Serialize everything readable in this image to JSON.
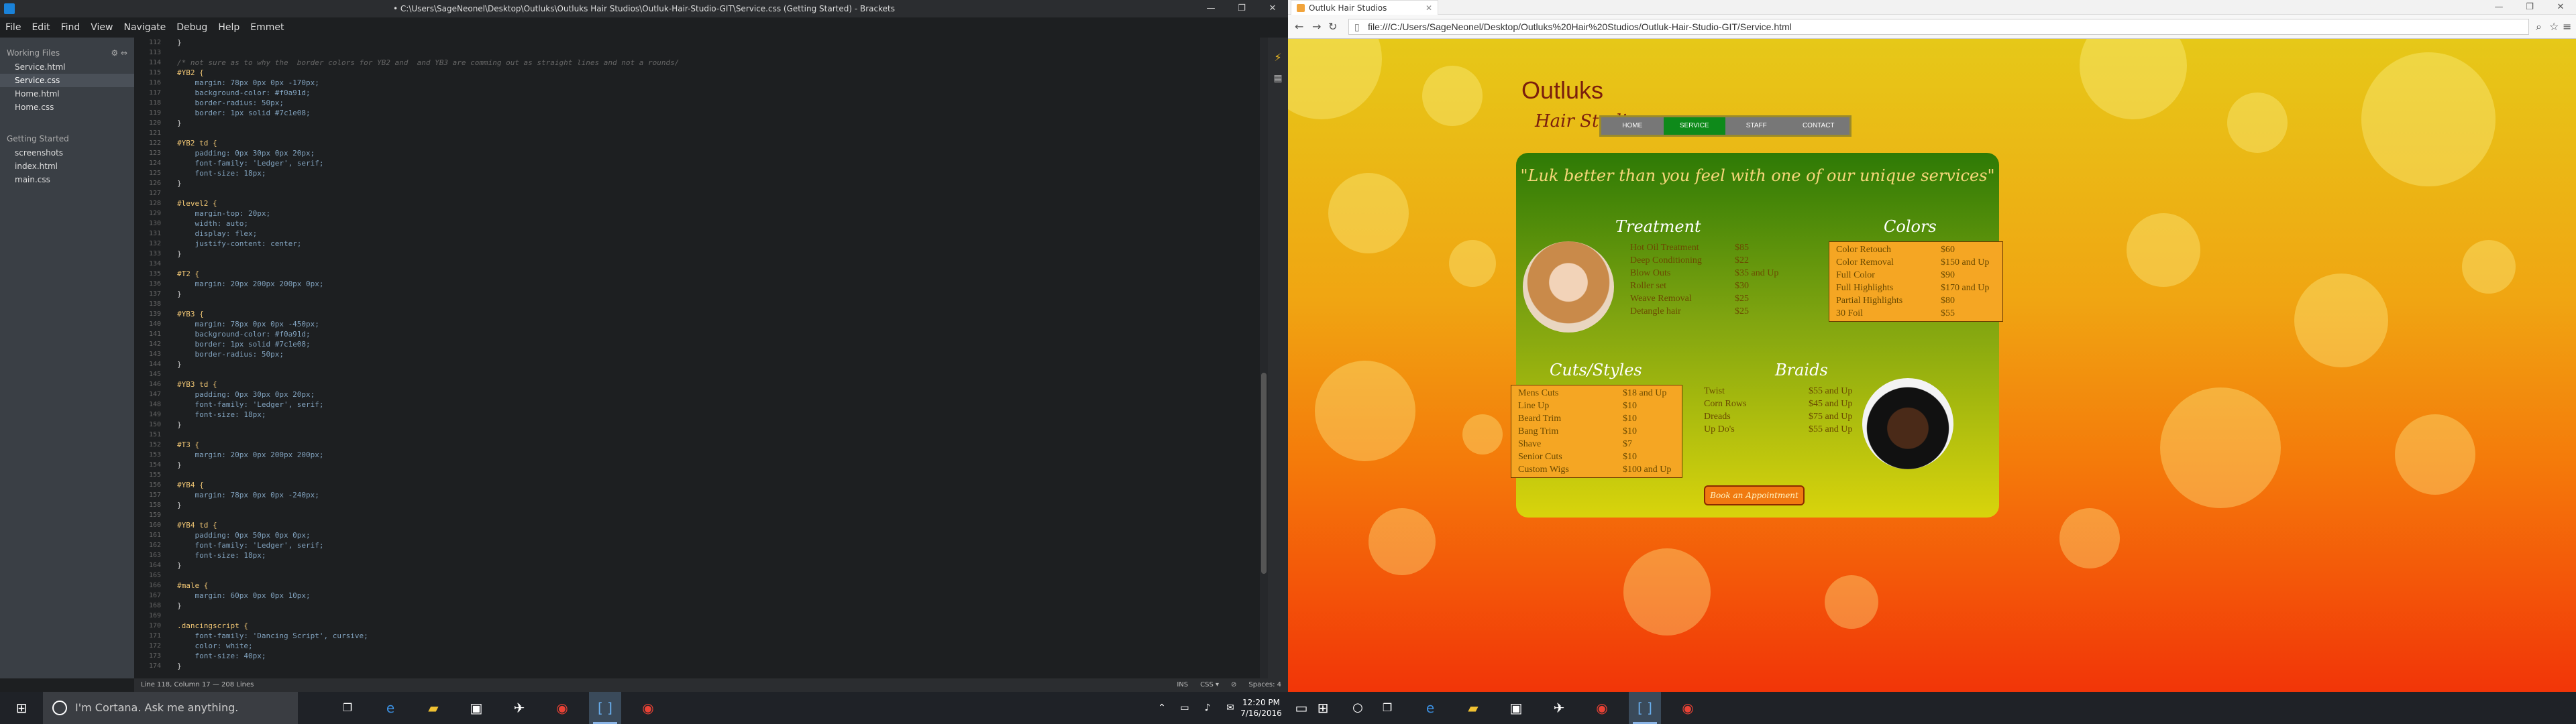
{
  "editor": {
    "title": "• C:\\Users\\SageNeonel\\Desktop\\Outluks\\Outluks Hair Studios\\Outluk-Hair-Studio-GIT\\Service.css (Getting Started) - Brackets",
    "menu": [
      "File",
      "Edit",
      "Find",
      "View",
      "Navigate",
      "Debug",
      "Help",
      "Emmet"
    ],
    "sidebar": {
      "working_files_label": "Working Files",
      "working_files": [
        "Service.html",
        "Service.css",
        "Home.html",
        "Home.css"
      ],
      "project_label": "Getting Started",
      "project_files": [
        "screenshots",
        "index.html",
        "main.css"
      ]
    },
    "code": [
      {
        "n": "112",
        "t": "}",
        "k": "p"
      },
      {
        "n": "113",
        "t": "",
        "k": "p"
      },
      {
        "n": "114",
        "t": "/* not sure as to why the  border colors for YB2 and  and YB3 are comming out as straight lines and not a rounds/",
        "k": "cmt"
      },
      {
        "n": "115",
        "t": "#YB2 {",
        "k": "sel"
      },
      {
        "n": "116",
        "t": "    margin: 78px 0px 0px -170px;",
        "k": "prop"
      },
      {
        "n": "117",
        "t": "    background-color: #f0a91d;",
        "k": "prop"
      },
      {
        "n": "118",
        "t": "    border-radius: 50px;",
        "k": "prop"
      },
      {
        "n": "119",
        "t": "    border: 1px solid #7c1e08;",
        "k": "prop"
      },
      {
        "n": "120",
        "t": "}",
        "k": "p"
      },
      {
        "n": "121",
        "t": "",
        "k": "p"
      },
      {
        "n": "122",
        "t": "#YB2 td {",
        "k": "sel"
      },
      {
        "n": "123",
        "t": "    padding: 0px 30px 0px 20px;",
        "k": "prop"
      },
      {
        "n": "124",
        "t": "    font-family: 'Ledger', serif;",
        "k": "prop"
      },
      {
        "n": "125",
        "t": "    font-size: 18px;",
        "k": "prop"
      },
      {
        "n": "126",
        "t": "}",
        "k": "p"
      },
      {
        "n": "127",
        "t": "",
        "k": "p"
      },
      {
        "n": "128",
        "t": "#level2 {",
        "k": "sel"
      },
      {
        "n": "129",
        "t": "    margin-top: 20px;",
        "k": "prop"
      },
      {
        "n": "130",
        "t": "    width: auto;",
        "k": "prop"
      },
      {
        "n": "131",
        "t": "    display: flex;",
        "k": "prop"
      },
      {
        "n": "132",
        "t": "    justify-content: center;",
        "k": "prop"
      },
      {
        "n": "133",
        "t": "}",
        "k": "p"
      },
      {
        "n": "134",
        "t": "",
        "k": "p"
      },
      {
        "n": "135",
        "t": "#T2 {",
        "k": "sel"
      },
      {
        "n": "136",
        "t": "    margin: 20px 200px 200px 0px;",
        "k": "prop"
      },
      {
        "n": "137",
        "t": "}",
        "k": "p"
      },
      {
        "n": "138",
        "t": "",
        "k": "p"
      },
      {
        "n": "139",
        "t": "#YB3 {",
        "k": "sel"
      },
      {
        "n": "140",
        "t": "    margin: 78px 0px 0px -450px;",
        "k": "prop"
      },
      {
        "n": "141",
        "t": "    background-color: #f0a91d;",
        "k": "prop"
      },
      {
        "n": "142",
        "t": "    border: 1px solid #7c1e08;",
        "k": "prop"
      },
      {
        "n": "143",
        "t": "    border-radius: 50px;",
        "k": "prop"
      },
      {
        "n": "144",
        "t": "}",
        "k": "p"
      },
      {
        "n": "145",
        "t": "",
        "k": "p"
      },
      {
        "n": "146",
        "t": "#YB3 td {",
        "k": "sel"
      },
      {
        "n": "147",
        "t": "    padding: 0px 30px 0px 20px;",
        "k": "prop"
      },
      {
        "n": "148",
        "t": "    font-family: 'Ledger', serif;",
        "k": "prop"
      },
      {
        "n": "149",
        "t": "    font-size: 18px;",
        "k": "prop"
      },
      {
        "n": "150",
        "t": "}",
        "k": "p"
      },
      {
        "n": "151",
        "t": "",
        "k": "p"
      },
      {
        "n": "152",
        "t": "#T3 {",
        "k": "sel"
      },
      {
        "n": "153",
        "t": "    margin: 20px 0px 200px 200px;",
        "k": "prop"
      },
      {
        "n": "154",
        "t": "}",
        "k": "p"
      },
      {
        "n": "155",
        "t": "",
        "k": "p"
      },
      {
        "n": "156",
        "t": "#YB4 {",
        "k": "sel"
      },
      {
        "n": "157",
        "t": "    margin: 78px 0px 0px -240px;",
        "k": "prop"
      },
      {
        "n": "158",
        "t": "}",
        "k": "p"
      },
      {
        "n": "159",
        "t": "",
        "k": "p"
      },
      {
        "n": "160",
        "t": "#YB4 td {",
        "k": "sel"
      },
      {
        "n": "161",
        "t": "    padding: 0px 50px 0px 0px;",
        "k": "prop"
      },
      {
        "n": "162",
        "t": "    font-family: 'Ledger', serif;",
        "k": "prop"
      },
      {
        "n": "163",
        "t": "    font-size: 18px;",
        "k": "prop"
      },
      {
        "n": "164",
        "t": "}",
        "k": "p"
      },
      {
        "n": "165",
        "t": "",
        "k": "p"
      },
      {
        "n": "166",
        "t": "#male {",
        "k": "sel"
      },
      {
        "n": "167",
        "t": "    margin: 60px 0px 0px 10px;",
        "k": "prop"
      },
      {
        "n": "168",
        "t": "}",
        "k": "p"
      },
      {
        "n": "169",
        "t": "",
        "k": "p"
      },
      {
        "n": "170",
        "t": ".dancingscript {",
        "k": "sel"
      },
      {
        "n": "171",
        "t": "    font-family: 'Dancing Script', cursive;",
        "k": "prop"
      },
      {
        "n": "172",
        "t": "    color: white;",
        "k": "prop"
      },
      {
        "n": "173",
        "t": "    font-size: 40px;",
        "k": "prop"
      },
      {
        "n": "174",
        "t": "}",
        "k": "p"
      }
    ],
    "status_left": "Line 118, Column 17 — 208 Lines",
    "status_right": [
      "INS",
      "CSS ▾",
      "⊘",
      "Spaces: 4"
    ]
  },
  "browser": {
    "tab_title": "Outluk Hair Studios",
    "url": "file:///C:/Users/SageNeonel/Desktop/Outluks%20Hair%20Studios/Outluk-Hair-Studio-GIT/Service.html",
    "site": {
      "brand": "Outluks",
      "brand_sub": "Hair Studios",
      "nav": [
        "HOME",
        "SERVICE",
        "STAFF",
        "CONTACT"
      ],
      "quote": "\"Luk better than you feel with one of our unique services\"",
      "treatment_title": "Treatment",
      "treatment": [
        {
          "name": "Hot Oil Treatment",
          "price": "$85"
        },
        {
          "name": "Deep Conditioning",
          "price": "$22"
        },
        {
          "name": "Blow Outs",
          "price": "$35 and Up"
        },
        {
          "name": "Roller set",
          "price": "$30"
        },
        {
          "name": "Weave Removal",
          "price": "$25"
        },
        {
          "name": "Detangle hair",
          "price": "$25"
        }
      ],
      "colors_title": "Colors",
      "colors": [
        {
          "name": "Color Retouch",
          "price": "$60"
        },
        {
          "name": "Color Removal",
          "price": "$150 and Up"
        },
        {
          "name": "Full Color",
          "price": "$90"
        },
        {
          "name": "Full Highlights",
          "price": "$170 and Up"
        },
        {
          "name": "Partial Highlights",
          "price": "$80"
        },
        {
          "name": "30 Foil",
          "price": "$55"
        }
      ],
      "cuts_title": "Cuts/Styles",
      "cuts": [
        {
          "name": "Mens Cuts",
          "price": "$18 and Up"
        },
        {
          "name": "Line Up",
          "price": "$10"
        },
        {
          "name": "Beard Trim",
          "price": "$10"
        },
        {
          "name": "Bang Trim",
          "price": "$10"
        },
        {
          "name": "Shave",
          "price": "$7"
        },
        {
          "name": "Senior Cuts",
          "price": "$10"
        },
        {
          "name": "Custom Wigs",
          "price": "$100 and Up"
        }
      ],
      "braids_title": "Braids",
      "braids": [
        {
          "name": "Twist",
          "price": "$55 and Up"
        },
        {
          "name": "Corn Rows",
          "price": "$45 and Up"
        },
        {
          "name": "Dreads",
          "price": "$75 and Up"
        },
        {
          "name": "Up Do's",
          "price": "$55 and Up"
        }
      ],
      "book_button": "Book an Appointment"
    }
  },
  "taskbar": {
    "cortana": "I'm Cortana. Ask me anything.",
    "time": "12:20 PM",
    "date": "7/16/2016"
  }
}
